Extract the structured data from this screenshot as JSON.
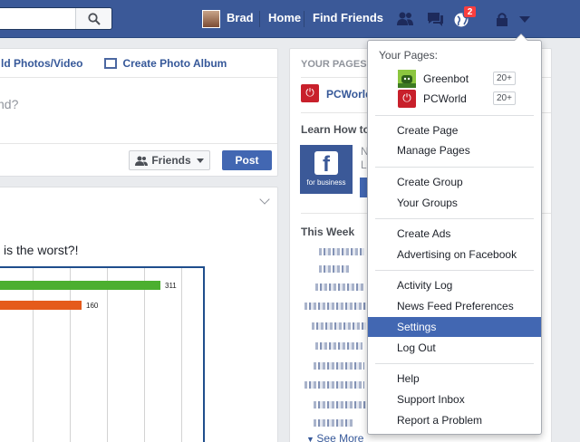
{
  "topbar": {
    "user_name": "Brad",
    "home_label": "Home",
    "find_friends_label": "Find Friends",
    "notification_count": "2"
  },
  "composer": {
    "photo_video_label": "ld Photos/Video",
    "create_album_label": "Create Photo Album",
    "placeholder": "nd?",
    "audience_label": "Friends",
    "post_label": "Post"
  },
  "post": {
    "text": "l is the worst?!"
  },
  "chart_data": {
    "type": "bar",
    "orientation": "horizontal",
    "categories": [
      "",
      ""
    ],
    "values": [
      311,
      160
    ],
    "value_labels": [
      "311",
      "160"
    ],
    "colors": [
      "#4caf30",
      "#e55b1b"
    ]
  },
  "rightcol": {
    "your_pages_header": "YOUR PAGES",
    "pcworld_label": "PCWorld",
    "learn_how_label": "Learn How to",
    "learn_line1": "N",
    "learn_line2": "Le",
    "fb_business_caption": "for business",
    "this_week_header": "This Week",
    "see_more_label": "See More"
  },
  "menu": {
    "your_pages_label": "Your Pages:",
    "pages": [
      {
        "name": "Greenbot",
        "count": "20+"
      },
      {
        "name": "PCWorld",
        "count": "20+"
      }
    ],
    "items": [
      "Create Page",
      "Manage Pages",
      "Create Group",
      "Your Groups",
      "Create Ads",
      "Advertising on Facebook",
      "Activity Log",
      "News Feed Preferences",
      "Settings",
      "Log Out",
      "Help",
      "Support Inbox",
      "Report a Problem"
    ]
  },
  "colors": {
    "brand_blue": "#3b5998",
    "highlight": "#4267b2",
    "badge_red": "#fa3e3e"
  }
}
